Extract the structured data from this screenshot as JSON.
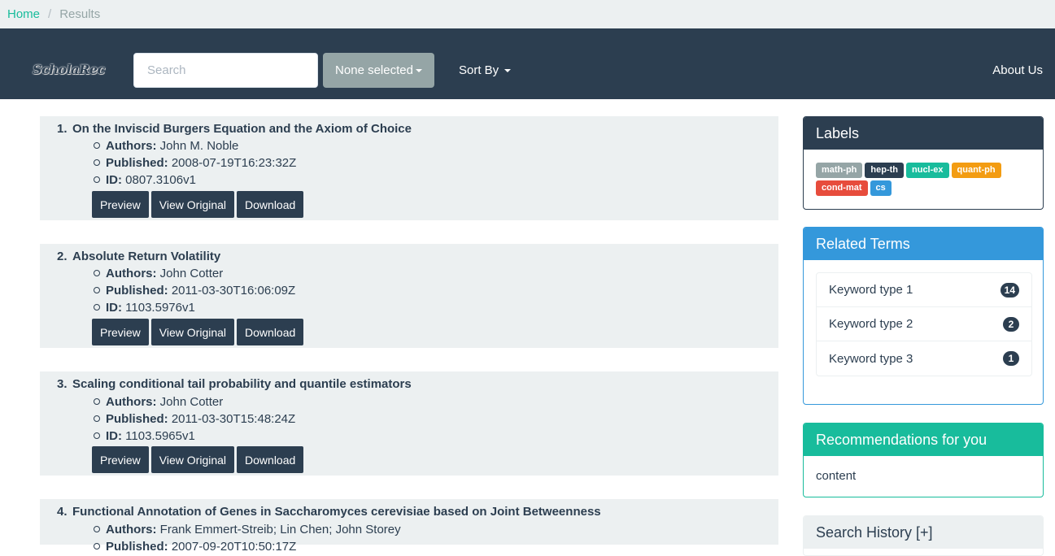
{
  "breadcrumb": {
    "home": "Home",
    "current": "Results"
  },
  "navbar": {
    "logo": "ScholaRec",
    "search_placeholder": "Search",
    "multiselect": "None selected",
    "sort_by": "Sort By",
    "about": "About Us"
  },
  "results": [
    {
      "num": "1.",
      "title": "On the Inviscid Burgers Equation and the Axiom of Choice",
      "authors_label": "Authors:",
      "authors": "John M. Noble",
      "published_label": "Published:",
      "published": "2008-07-19T16:23:32Z",
      "id_label": "ID:",
      "id": "0807.3106v1"
    },
    {
      "num": "2.",
      "title": "Absolute Return Volatility",
      "authors_label": "Authors:",
      "authors": "John Cotter",
      "published_label": "Published:",
      "published": "2011-03-30T16:06:09Z",
      "id_label": "ID:",
      "id": "1103.5976v1"
    },
    {
      "num": "3.",
      "title": "Scaling conditional tail probability and quantile estimators",
      "authors_label": "Authors:",
      "authors": "John Cotter",
      "published_label": "Published:",
      "published": "2011-03-30T15:48:24Z",
      "id_label": "ID:",
      "id": "1103.5965v1"
    },
    {
      "num": "4.",
      "title": "Functional Annotation of Genes in Saccharomyces cerevisiae based on Joint Betweenness",
      "authors_label": "Authors:",
      "authors": "Frank Emmert-Streib; Lin Chen; John Storey",
      "published_label": "Published:",
      "published": "2007-09-20T10:50:17Z",
      "id_label": "ID:",
      "id": ""
    }
  ],
  "buttons": {
    "preview": "Preview",
    "view_original": "View Original",
    "download": "Download"
  },
  "labels_panel": {
    "title": "Labels",
    "labels": [
      {
        "text": "math-ph",
        "color": "#95a5a6"
      },
      {
        "text": "hep-th",
        "color": "#2c3e50"
      },
      {
        "text": "nucl-ex",
        "color": "#18bc9c"
      },
      {
        "text": "quant-ph",
        "color": "#f39c12"
      },
      {
        "text": "cond-mat",
        "color": "#e74c3c"
      },
      {
        "text": "cs",
        "color": "#3498db"
      }
    ]
  },
  "related_terms": {
    "title": "Related Terms",
    "items": [
      {
        "label": "Keyword type 1",
        "count": "14"
      },
      {
        "label": "Keyword type 2",
        "count": "2"
      },
      {
        "label": "Keyword type 3",
        "count": "1"
      }
    ]
  },
  "recommendations": {
    "title": "Recommendations for you",
    "content": "content"
  },
  "search_history": {
    "title": "Search History [+]"
  }
}
